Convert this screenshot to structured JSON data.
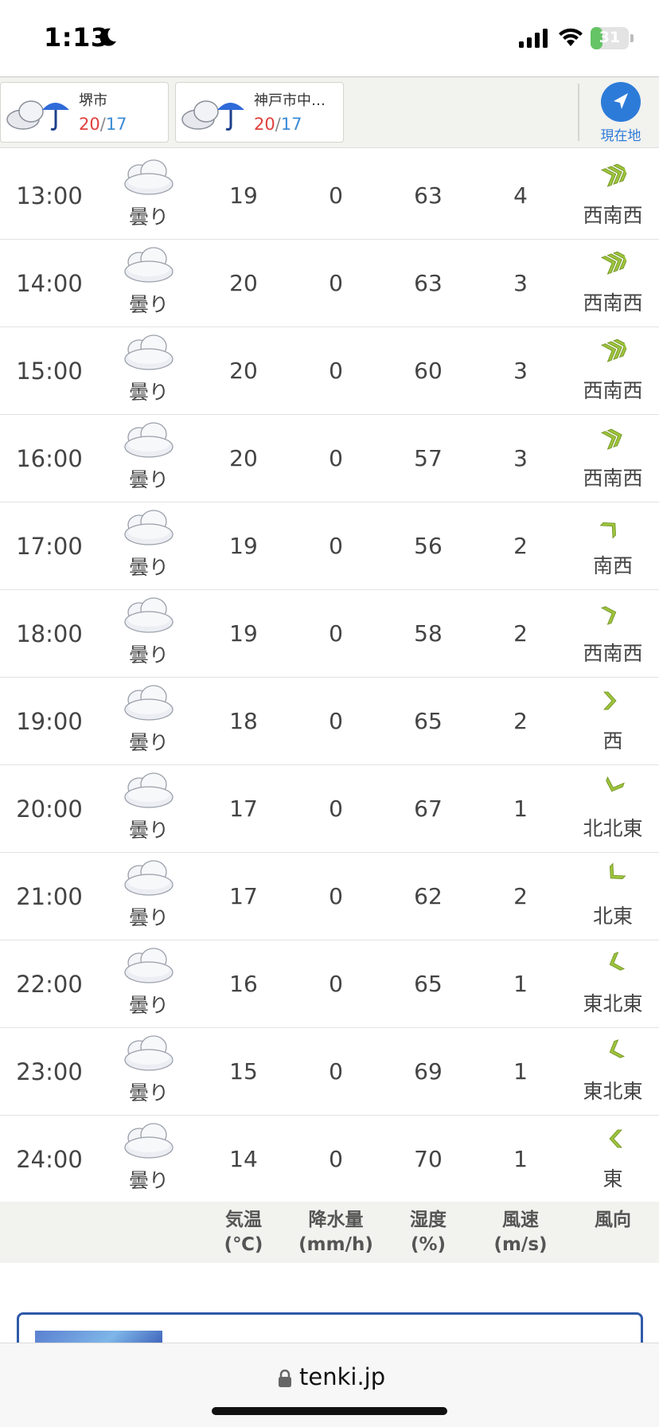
{
  "status_bar": {
    "time": "1:13",
    "battery": "31",
    "battery_level": 0.31,
    "icons": [
      "moon-icon",
      "signal-icon",
      "wifi-icon",
      "battery-icon"
    ]
  },
  "locations": [
    {
      "name": "堺市",
      "high": "20",
      "low": "17",
      "icon": "cloud-umbrella-icon"
    },
    {
      "name": "神戸市中…",
      "high": "20",
      "low": "17",
      "icon": "cloud-umbrella-icon"
    }
  ],
  "temp_separator": "/",
  "current_location_label": "現在地",
  "hourly": [
    {
      "time": "13:00",
      "weather": "曇り",
      "temp": "19",
      "precip": "0",
      "humidity": "63",
      "wind_speed": "4",
      "wind_dir": "西南西",
      "arrow_chevrons": 3,
      "arrow_deg": -20
    },
    {
      "time": "14:00",
      "weather": "曇り",
      "temp": "20",
      "precip": "0",
      "humidity": "63",
      "wind_speed": "3",
      "wind_dir": "西南西",
      "arrow_chevrons": 3,
      "arrow_deg": -20
    },
    {
      "time": "15:00",
      "weather": "曇り",
      "temp": "20",
      "precip": "0",
      "humidity": "60",
      "wind_speed": "3",
      "wind_dir": "西南西",
      "arrow_chevrons": 3,
      "arrow_deg": -20
    },
    {
      "time": "16:00",
      "weather": "曇り",
      "temp": "20",
      "precip": "0",
      "humidity": "57",
      "wind_speed": "3",
      "wind_dir": "西南西",
      "arrow_chevrons": 2,
      "arrow_deg": -20
    },
    {
      "time": "17:00",
      "weather": "曇り",
      "temp": "19",
      "precip": "0",
      "humidity": "56",
      "wind_speed": "2",
      "wind_dir": "南西",
      "arrow_chevrons": 1,
      "arrow_deg": -45
    },
    {
      "time": "18:00",
      "weather": "曇り",
      "temp": "19",
      "precip": "0",
      "humidity": "58",
      "wind_speed": "2",
      "wind_dir": "西南西",
      "arrow_chevrons": 1,
      "arrow_deg": -20
    },
    {
      "time": "19:00",
      "weather": "曇り",
      "temp": "18",
      "precip": "0",
      "humidity": "65",
      "wind_speed": "2",
      "wind_dir": "西",
      "arrow_chevrons": 1,
      "arrow_deg": 0
    },
    {
      "time": "20:00",
      "weather": "曇り",
      "temp": "17",
      "precip": "0",
      "humidity": "67",
      "wind_speed": "1",
      "wind_dir": "北北東",
      "arrow_chevrons": 1,
      "arrow_deg": 110
    },
    {
      "time": "21:00",
      "weather": "曇り",
      "temp": "17",
      "precip": "0",
      "humidity": "62",
      "wind_speed": "2",
      "wind_dir": "北東",
      "arrow_chevrons": 1,
      "arrow_deg": 135
    },
    {
      "time": "22:00",
      "weather": "曇り",
      "temp": "16",
      "precip": "0",
      "humidity": "65",
      "wind_speed": "1",
      "wind_dir": "東北東",
      "arrow_chevrons": 1,
      "arrow_deg": 160
    },
    {
      "time": "23:00",
      "weather": "曇り",
      "temp": "15",
      "precip": "0",
      "humidity": "69",
      "wind_speed": "1",
      "wind_dir": "東北東",
      "arrow_chevrons": 1,
      "arrow_deg": 160
    },
    {
      "time": "24:00",
      "weather": "曇り",
      "temp": "14",
      "precip": "0",
      "humidity": "70",
      "wind_speed": "1",
      "wind_dir": "東",
      "arrow_chevrons": 1,
      "arrow_deg": 180
    }
  ],
  "legend": [
    {
      "line1": "気温",
      "line2": "(℃)"
    },
    {
      "line1": "降水量",
      "line2": "(mm/h)"
    },
    {
      "line1": "湿度",
      "line2": "(%)"
    },
    {
      "line1": "風速",
      "line2": "(m/s)"
    },
    {
      "line1": "風向",
      "line2": ""
    }
  ],
  "browser": {
    "url": "tenki.jp"
  },
  "colors": {
    "high_temp": "#e0413d",
    "low_temp": "#3b8cd6",
    "arrow": "#9cc43c",
    "accent": "#2d7bd9",
    "header_bg": "#f2f2ee"
  }
}
